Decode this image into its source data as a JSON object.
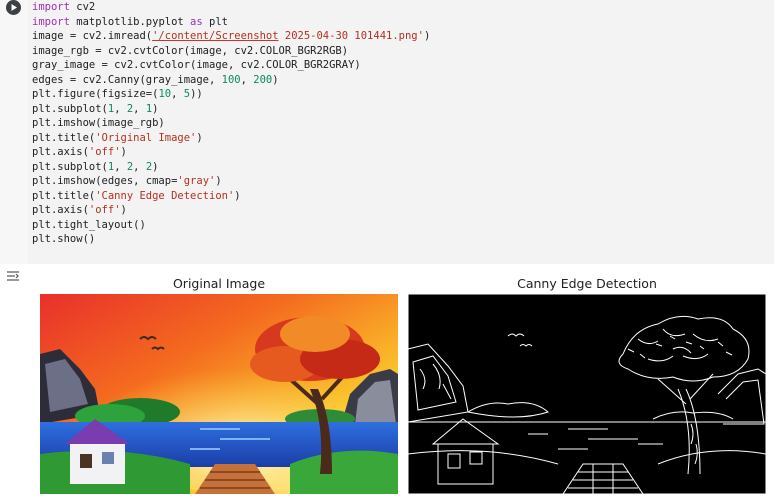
{
  "code_cell": {
    "lines": [
      [
        {
          "t": "import",
          "c": "kw"
        },
        {
          "t": " cv2",
          "c": ""
        }
      ],
      [
        {
          "t": "import",
          "c": "kw"
        },
        {
          "t": " matplotlib.pyplot ",
          "c": ""
        },
        {
          "t": "as",
          "c": "kw"
        },
        {
          "t": " plt",
          "c": ""
        }
      ],
      [
        {
          "t": "image = cv2.imread(",
          "c": ""
        },
        {
          "t": "'/content/Screenshot",
          "c": "str underl"
        },
        {
          "t": " 2025-04-30 101441.png'",
          "c": "str"
        },
        {
          "t": ")",
          "c": ""
        }
      ],
      [
        {
          "t": "image_rgb = cv2.cvtColor(image, cv2.COLOR_BGR2RGB)",
          "c": ""
        }
      ],
      [
        {
          "t": "gray_image = cv2.cvtColor(image, cv2.COLOR_BGR2GRAY)",
          "c": ""
        }
      ],
      [
        {
          "t": "edges = cv2.Canny(gray_image, ",
          "c": ""
        },
        {
          "t": "100",
          "c": "num"
        },
        {
          "t": ", ",
          "c": ""
        },
        {
          "t": "200",
          "c": "num"
        },
        {
          "t": ")",
          "c": ""
        }
      ],
      [
        {
          "t": "plt.figure(figsize=(",
          "c": ""
        },
        {
          "t": "10",
          "c": "num"
        },
        {
          "t": ", ",
          "c": ""
        },
        {
          "t": "5",
          "c": "num"
        },
        {
          "t": "))",
          "c": ""
        }
      ],
      [
        {
          "t": "plt.subplot(",
          "c": ""
        },
        {
          "t": "1",
          "c": "num"
        },
        {
          "t": ", ",
          "c": ""
        },
        {
          "t": "2",
          "c": "num"
        },
        {
          "t": ", ",
          "c": ""
        },
        {
          "t": "1",
          "c": "num"
        },
        {
          "t": ")",
          "c": ""
        }
      ],
      [
        {
          "t": "plt.imshow(image_rgb)",
          "c": ""
        }
      ],
      [
        {
          "t": "plt.title(",
          "c": ""
        },
        {
          "t": "'Original Image'",
          "c": "str"
        },
        {
          "t": ")",
          "c": ""
        }
      ],
      [
        {
          "t": "plt.axis(",
          "c": ""
        },
        {
          "t": "'off'",
          "c": "str"
        },
        {
          "t": ")",
          "c": ""
        }
      ],
      [
        {
          "t": "plt.subplot(",
          "c": ""
        },
        {
          "t": "1",
          "c": "num"
        },
        {
          "t": ", ",
          "c": ""
        },
        {
          "t": "2",
          "c": "num"
        },
        {
          "t": ", ",
          "c": ""
        },
        {
          "t": "2",
          "c": "num"
        },
        {
          "t": ")",
          "c": ""
        }
      ],
      [
        {
          "t": "plt.imshow(edges, cmap=",
          "c": ""
        },
        {
          "t": "'gray'",
          "c": "str"
        },
        {
          "t": ")",
          "c": ""
        }
      ],
      [
        {
          "t": "plt.title(",
          "c": ""
        },
        {
          "t": "'Canny Edge Detection'",
          "c": "str"
        },
        {
          "t": ")",
          "c": ""
        }
      ],
      [
        {
          "t": "plt.axis(",
          "c": ""
        },
        {
          "t": "'off'",
          "c": "str"
        },
        {
          "t": ")",
          "c": ""
        }
      ],
      [
        {
          "t": "plt.tight_layout()",
          "c": ""
        }
      ],
      [
        {
          "t": "plt.show()",
          "c": ""
        }
      ]
    ]
  },
  "output": {
    "title_left": "Original Image",
    "title_right": "Canny Edge Detection"
  },
  "icons": {
    "run": "play-icon",
    "output_toggle": "output-settings-icon"
  },
  "colors": {
    "keyword": "#9b30b7",
    "string": "#b5311c",
    "number": "#0d8a5e"
  }
}
